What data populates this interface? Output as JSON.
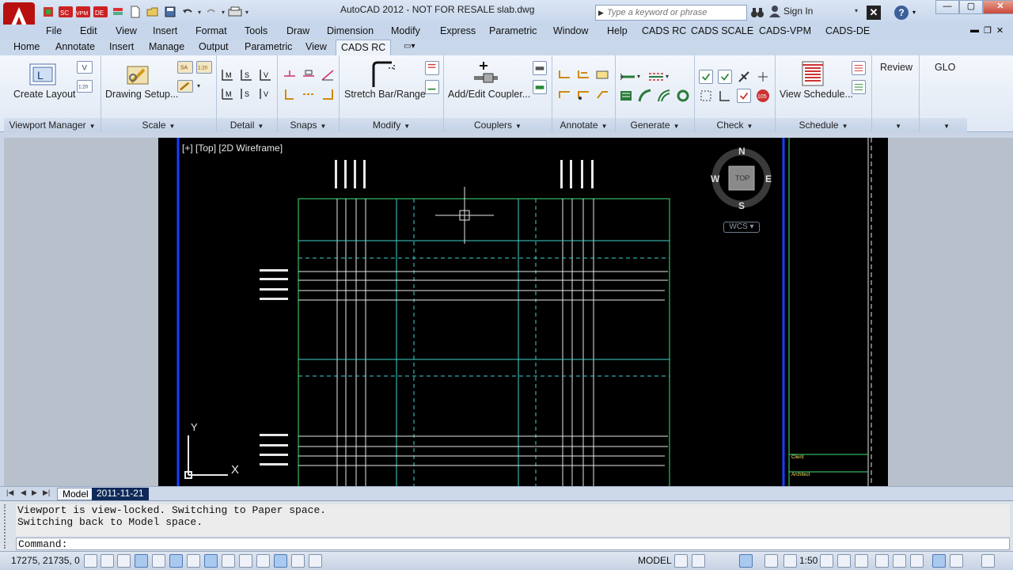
{
  "title_bar": {
    "app_title": "AutoCAD 2012 - NOT FOR RESALE",
    "file_name": "slab.dwg",
    "search_placeholder": "Type a keyword or phrase",
    "sign_in": "Sign In",
    "qat_labels": [
      "SC",
      "VPM",
      "DE"
    ]
  },
  "menu": [
    "File",
    "Edit",
    "View",
    "Insert",
    "Format",
    "Tools",
    "Draw",
    "Dimension",
    "Modify",
    "Express",
    "Parametric",
    "Window",
    "Help",
    "CADS RC",
    "CADS SCALE",
    "CADS-VPM",
    "CADS-DE"
  ],
  "ribbon_tabs": [
    "Home",
    "Annotate",
    "Insert",
    "Manage",
    "Output",
    "Parametric",
    "View",
    "CADS RC"
  ],
  "active_tab": "CADS RC",
  "ribbon": {
    "create_layout": "Create Layout",
    "drawing_setup": "Drawing Setup...",
    "stretch_bar": "Stretch Bar/Range",
    "add_edit_coupler": "Add/Edit Coupler...",
    "view_schedule": "View Schedule...",
    "review": "Review",
    "glo": "GLO",
    "icon_texts": {
      "v": "V",
      "ratio_1_20": "1:20",
      "sa": "SA",
      "l": "L",
      "m": "M",
      "s": "S",
      "check_105": "105"
    },
    "panels": [
      "Viewport Manager",
      "Scale",
      "Detail",
      "Snaps",
      "Modify",
      "Couplers",
      "Annotate",
      "Generate",
      "Check",
      "Schedule"
    ]
  },
  "viewport": {
    "label": "[+] [Top] [2D Wireframe]",
    "compass": {
      "n": "N",
      "s": "S",
      "e": "E",
      "w": "W",
      "cube": "TOP",
      "wcs": "WCS"
    },
    "ucs": {
      "x": "X",
      "y": "Y"
    },
    "titleblock": [
      "Client",
      "Architect"
    ]
  },
  "layout_tabs": [
    "Model",
    "2011-11-21"
  ],
  "command": {
    "history": [
      "Viewport is view-locked. Switching to Paper space.",
      "Switching back to Model space."
    ],
    "prompt": "Command:"
  },
  "status": {
    "coords": "17275, 21735, 0",
    "space": "MODEL",
    "scale": "1:50"
  }
}
